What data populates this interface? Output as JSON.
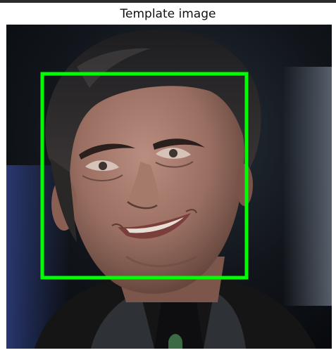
{
  "figure": {
    "title": "Template image"
  },
  "image": {
    "subject": "portrait-photo",
    "face_detection": {
      "box_color": "#00ff00"
    }
  },
  "colors": {
    "window_bar": "#2b2b2b",
    "title_text": "#111111",
    "background": "#ffffff"
  }
}
